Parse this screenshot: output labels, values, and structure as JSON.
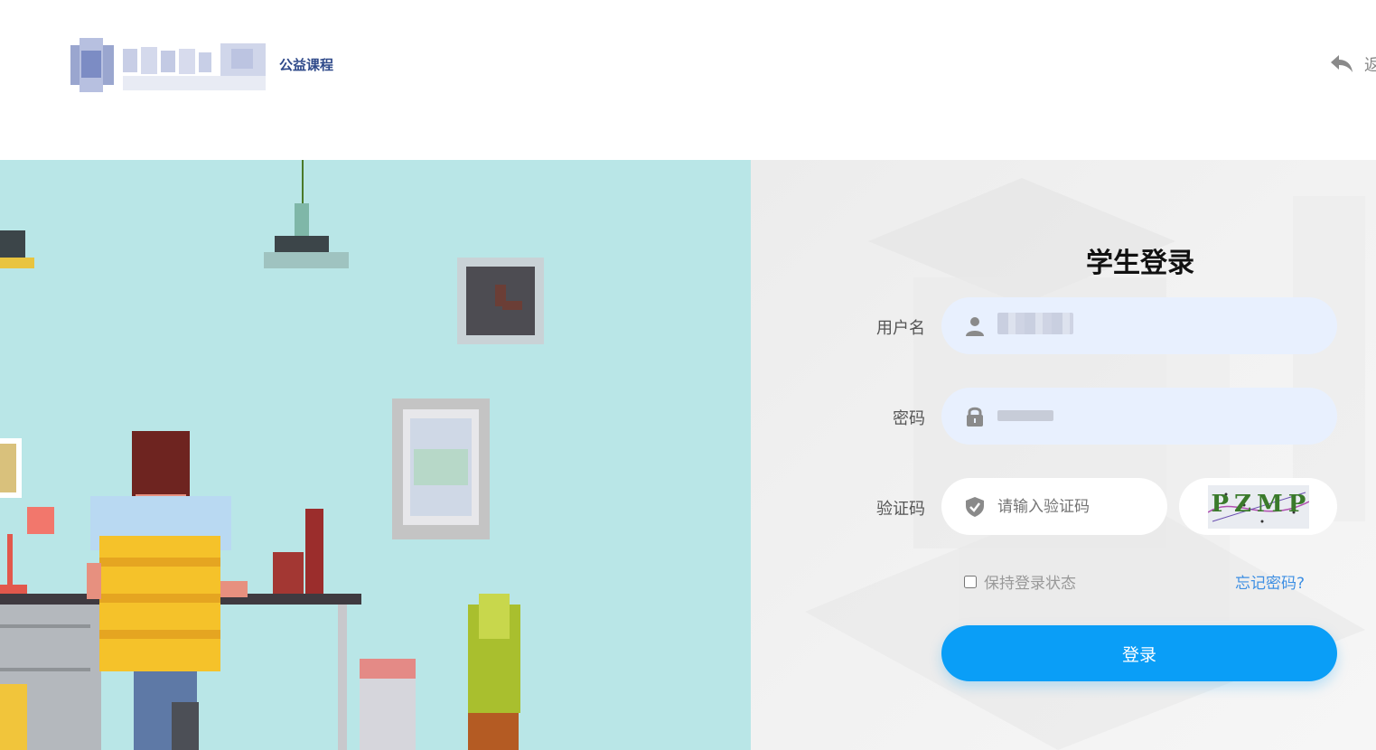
{
  "header": {
    "logo_subtitle": "公益课程",
    "back_label": "返"
  },
  "login": {
    "title": "学生登录",
    "username_label": "用户名",
    "password_label": "密码",
    "captcha_label": "验证码",
    "captcha_placeholder": "请输入验证码",
    "captcha_image_text": "PZMP",
    "remember_label": "保持登录状态",
    "forgot_label": "忘记密码?",
    "submit_label": "登录"
  },
  "icons": {
    "back": "reply-arrow-icon",
    "user": "user-icon",
    "lock": "lock-icon",
    "shield": "shield-check-icon"
  },
  "colors": {
    "brand_text": "#2f4a8a",
    "button": "#0a9ef7",
    "input_filled": "#e8f0fe",
    "link": "#3e8fe3",
    "banner_bg": "#b9e6e7"
  }
}
